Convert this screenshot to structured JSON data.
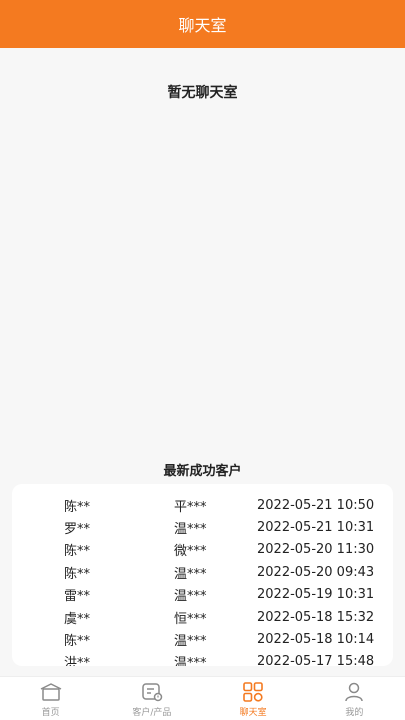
{
  "header": {
    "title": "聊天室"
  },
  "main": {
    "empty_message": "暂无聊天室"
  },
  "recent": {
    "title": "最新成功客户",
    "rows": [
      {
        "name": "陈**",
        "product": "平***",
        "time": "2022-05-21 10:50"
      },
      {
        "name": "罗**",
        "product": "温***",
        "time": "2022-05-21 10:31"
      },
      {
        "name": "陈**",
        "product": "微***",
        "time": "2022-05-20 11:30"
      },
      {
        "name": "陈**",
        "product": "温***",
        "time": "2022-05-20 09:43"
      },
      {
        "name": "雷**",
        "product": "温***",
        "time": "2022-05-19 10:31"
      },
      {
        "name": "虞**",
        "product": "恒***",
        "time": "2022-05-18 15:32"
      },
      {
        "name": "陈**",
        "product": "温***",
        "time": "2022-05-18 10:14"
      },
      {
        "name": "洪**",
        "product": "温***",
        "time": "2022-05-17 15:48"
      }
    ]
  },
  "tabbar": {
    "active_color": "#f47a20",
    "inactive_color": "#999999",
    "tabs": [
      {
        "label": "首页",
        "icon": "home-icon"
      },
      {
        "label": "客户/产品",
        "icon": "customer-product-icon"
      },
      {
        "label": "聊天室",
        "icon": "chatroom-grid-icon"
      },
      {
        "label": "我的",
        "icon": "profile-icon"
      }
    ]
  }
}
